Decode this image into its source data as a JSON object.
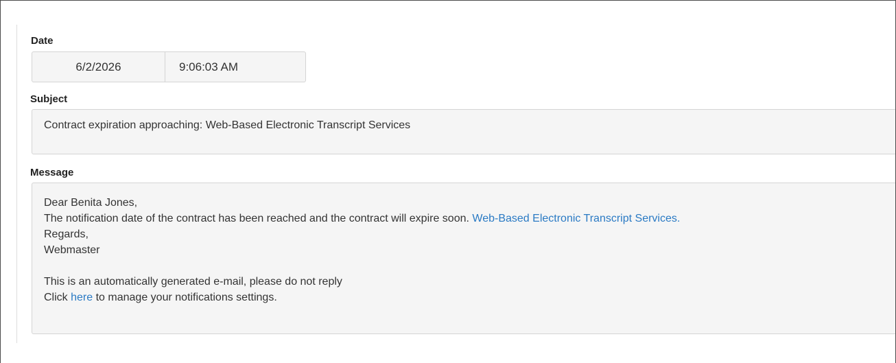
{
  "date_field": {
    "label": "Date",
    "date_value": "6/2/2026",
    "time_value": "9:06:03 AM"
  },
  "subject_field": {
    "label": "Subject",
    "value": "Contract expiration approaching: Web-Based Electronic Transcript Services"
  },
  "message_field": {
    "label": "Message",
    "greeting": "Dear Benita Jones,",
    "body_text": "The notification date of the contract has been reached and the contract will expire soon.",
    "contract_link": "Web-Based Electronic Transcript Services.",
    "regards": "Regards,",
    "signature": "Webmaster",
    "auto_notice": "This is an automatically generated e-mail, please do not reply",
    "click_prefix": "Click",
    "here_link": "here",
    "click_suffix": "to manage your notifications settings."
  },
  "colors": {
    "link": "#2a7ac4",
    "field_background": "#f5f5f5",
    "field_border": "#d4d4d4"
  }
}
